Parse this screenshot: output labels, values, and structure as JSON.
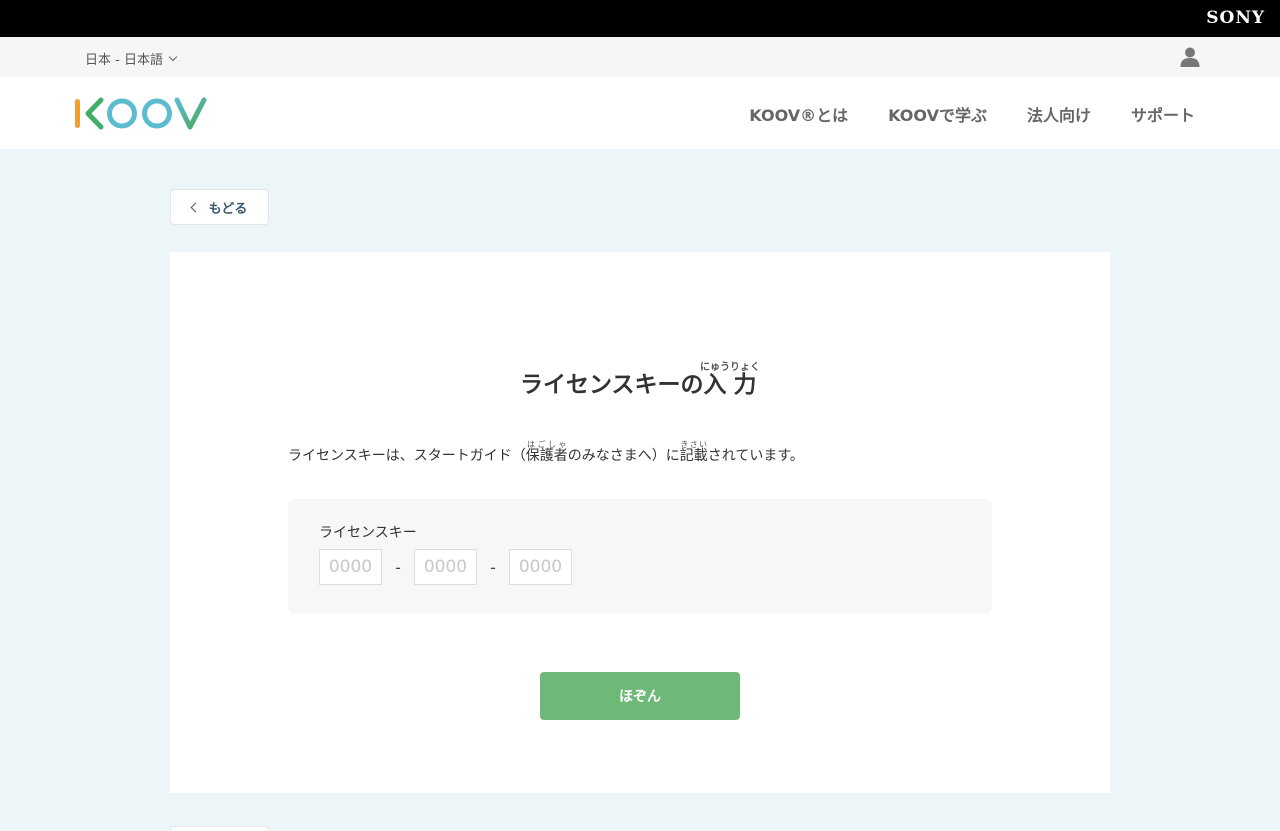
{
  "brand": {
    "sony_logo": "SONY"
  },
  "locale": {
    "current": "日本 - 日本語"
  },
  "nav": {
    "items": [
      "KOOV®とは",
      "KOOVで学ぶ",
      "法人向け",
      "サポート"
    ]
  },
  "back_button": {
    "label": "もどる"
  },
  "page": {
    "title_prefix": "ライセンスキーの",
    "title_ruby_base": "入力",
    "title_ruby_reading": "にゅうりょく",
    "desc_part1": "ライセンスキーは、スタートガイド（",
    "desc_ruby1_base": "保護者",
    "desc_ruby1_reading": "はごしゃ",
    "desc_part2": "のみなさまへ）に",
    "desc_ruby2_base": "記載",
    "desc_ruby2_reading": "きさい",
    "desc_part3": "されています。"
  },
  "license_key": {
    "label": "ライセンスキー",
    "placeholder": "0000",
    "separator": "-",
    "values": [
      "",
      "",
      ""
    ]
  },
  "save_button": {
    "label": "ほぞん"
  },
  "colors": {
    "top_bar": "#000000",
    "page_bg": "#ecf5f8",
    "save_button": "#6eb878",
    "logo_orange": "#f0a030",
    "logo_teal": "#5bbcd0",
    "logo_green": "#4aa85a"
  },
  "icons": {
    "user": "user-icon",
    "back": "chevron-left-icon",
    "locale": "chevron-down-icon"
  }
}
